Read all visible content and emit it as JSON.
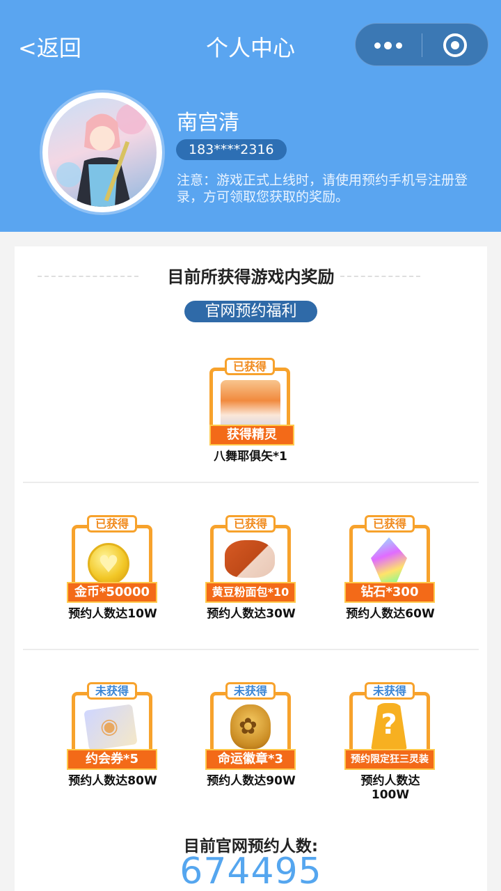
{
  "nav": {
    "back_label": "<返回",
    "title": "个人中心"
  },
  "profile": {
    "name": "南宫清",
    "phone": "183****2316",
    "notice": "注意：游戏正式上线时，请使用预约手机号注册登录，方可领取您获取的奖励。"
  },
  "rewards": {
    "section_title": "目前所获得游戏内奖励",
    "tag": "官网预约福利",
    "featured": {
      "status": "已获得",
      "label": "获得精灵",
      "caption": "八舞耶俱矢*1",
      "icon": "spirit-portrait-icon"
    },
    "row1": [
      {
        "status": "已获得",
        "label": "金币*50000",
        "condition": "预约人数达10W",
        "icon": "gold-coin-icon"
      },
      {
        "status": "已获得",
        "label": "黄豆粉面包*10",
        "condition": "预约人数达30W",
        "icon": "bread-icon"
      },
      {
        "status": "已获得",
        "label": "钻石*300",
        "condition": "预约人数达60W",
        "icon": "diamond-icon"
      }
    ],
    "row2": [
      {
        "status": "未获得",
        "label": "约会券*5",
        "condition": "预约人数达80W",
        "icon": "date-ticket-icon"
      },
      {
        "status": "未获得",
        "label": "命运徽章*3",
        "condition": "预约人数达90W",
        "icon": "fate-badge-icon"
      },
      {
        "status": "未获得",
        "label": "预约限定狂三灵装",
        "condition": "预约人数达100W",
        "icon": "mystery-question-icon"
      }
    ]
  },
  "reservation": {
    "label": "目前官网预约人数:",
    "count": "674495"
  },
  "colors": {
    "header_bg": "#5aa5f0",
    "accent_orange": "#f36a18",
    "count_blue": "#55a6ef"
  }
}
